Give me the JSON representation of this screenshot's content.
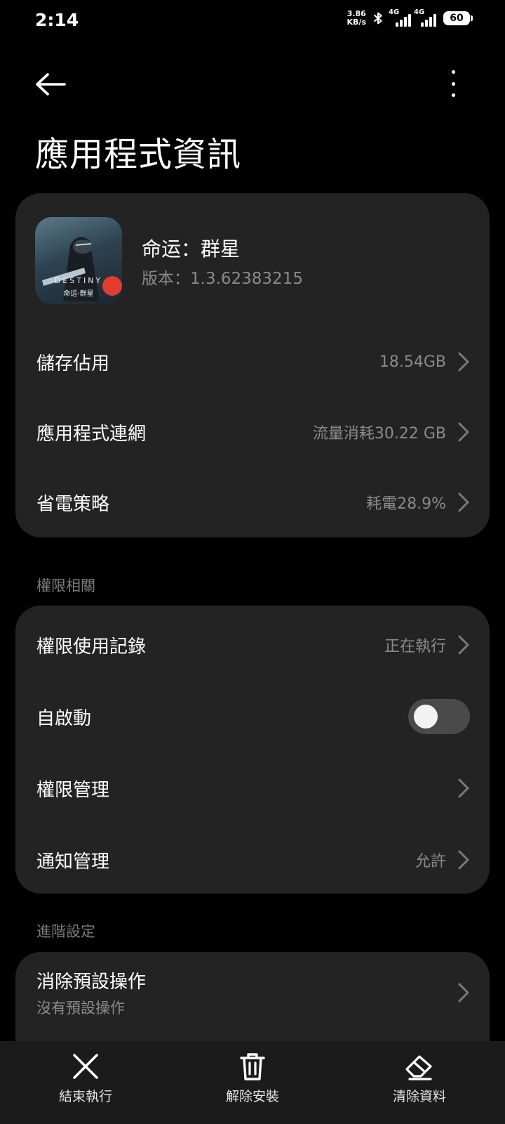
{
  "status_bar": {
    "time": "2:14",
    "net_speed_value": "3.86",
    "net_speed_unit": "KB/s",
    "signal1_label": "4G",
    "signal2_label": "4G",
    "battery": "60"
  },
  "header": {
    "title": "應用程式資訊",
    "back_icon": "arrow-left-icon",
    "more_icon": "more-vert-icon"
  },
  "app": {
    "name": "命运：群星",
    "version": "版本：1.3.62383215",
    "icon_text": "DESTINY",
    "icon_subtext": "命运·群星"
  },
  "info_rows": [
    {
      "label": "儲存佔用",
      "value": "18.54GB"
    },
    {
      "label": "應用程式連網",
      "value": "流量消耗30.22 GB"
    },
    {
      "label": "省電策略",
      "value": "耗電28.9%"
    }
  ],
  "permissions_section": {
    "heading": "權限相關",
    "rows": [
      {
        "label": "權限使用記錄",
        "value": "正在執行"
      },
      {
        "label": "自啟動",
        "toggle_on": false
      },
      {
        "label": "權限管理",
        "value": ""
      },
      {
        "label": "通知管理",
        "value": "允許"
      }
    ]
  },
  "advanced_section": {
    "heading": "進階設定",
    "rows": [
      {
        "label": "消除預設操作",
        "sublabel": "沒有預設操作"
      }
    ]
  },
  "bottom_actions": [
    {
      "label": "結束執行",
      "icon": "close-icon"
    },
    {
      "label": "解除安裝",
      "icon": "trash-icon"
    },
    {
      "label": "清除資料",
      "icon": "eraser-icon"
    }
  ],
  "colors": {
    "background": "#000000",
    "card": "#232323",
    "secondary_text": "#8a8a8a",
    "section_label": "#7b7b7b"
  }
}
